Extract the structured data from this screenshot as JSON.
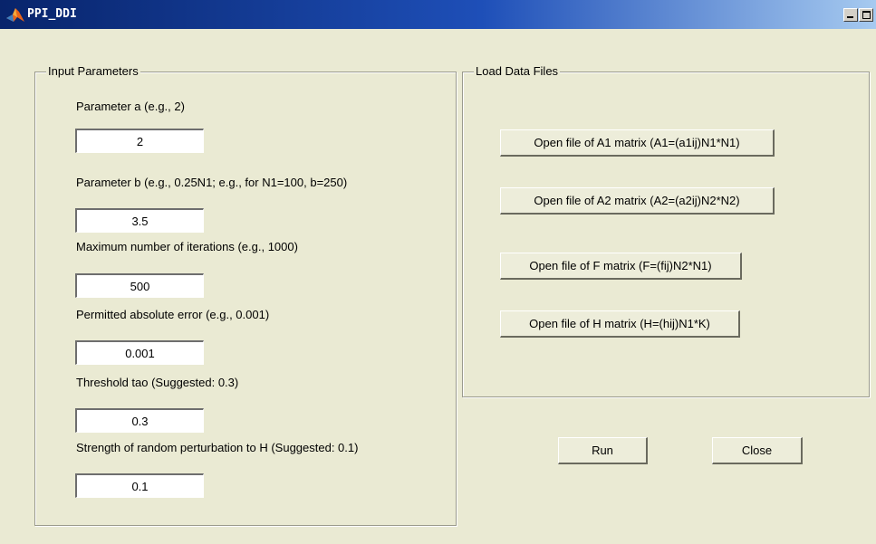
{
  "window": {
    "title": "PPI_DDI",
    "icon": "matlab-logo-icon",
    "title_bar_color": "#08246B"
  },
  "input_panel": {
    "title": "Input Parameters",
    "params": [
      {
        "label": "Parameter a (e.g., 2)",
        "value": "2"
      },
      {
        "label": "Parameter b (e.g., 0.25N1; e.g., for N1=100, b=250)",
        "value": "3.5"
      },
      {
        "label": "Maximum number of iterations (e.g., 1000)",
        "value": "500"
      },
      {
        "label": "Permitted absolute error (e.g., 0.001)",
        "value": "0.001"
      },
      {
        "label": "Threshold tao (Suggested: 0.3)",
        "value": "0.3"
      },
      {
        "label": "Strength of random perturbation to H (Suggested: 0.1)",
        "value": "0.1"
      }
    ]
  },
  "load_panel": {
    "title": "Load Data Files",
    "buttons": [
      "Open file of A1 matrix (A1=(a1ij)N1*N1)",
      "Open file of A2 matrix (A2=(a2ij)N2*N2)",
      "Open file of F matrix (F=(fij)N2*N1)",
      "Open file of H matrix (H=(hij)N1*K)"
    ]
  },
  "actions": {
    "run_label": "Run",
    "close_label": "Close"
  }
}
